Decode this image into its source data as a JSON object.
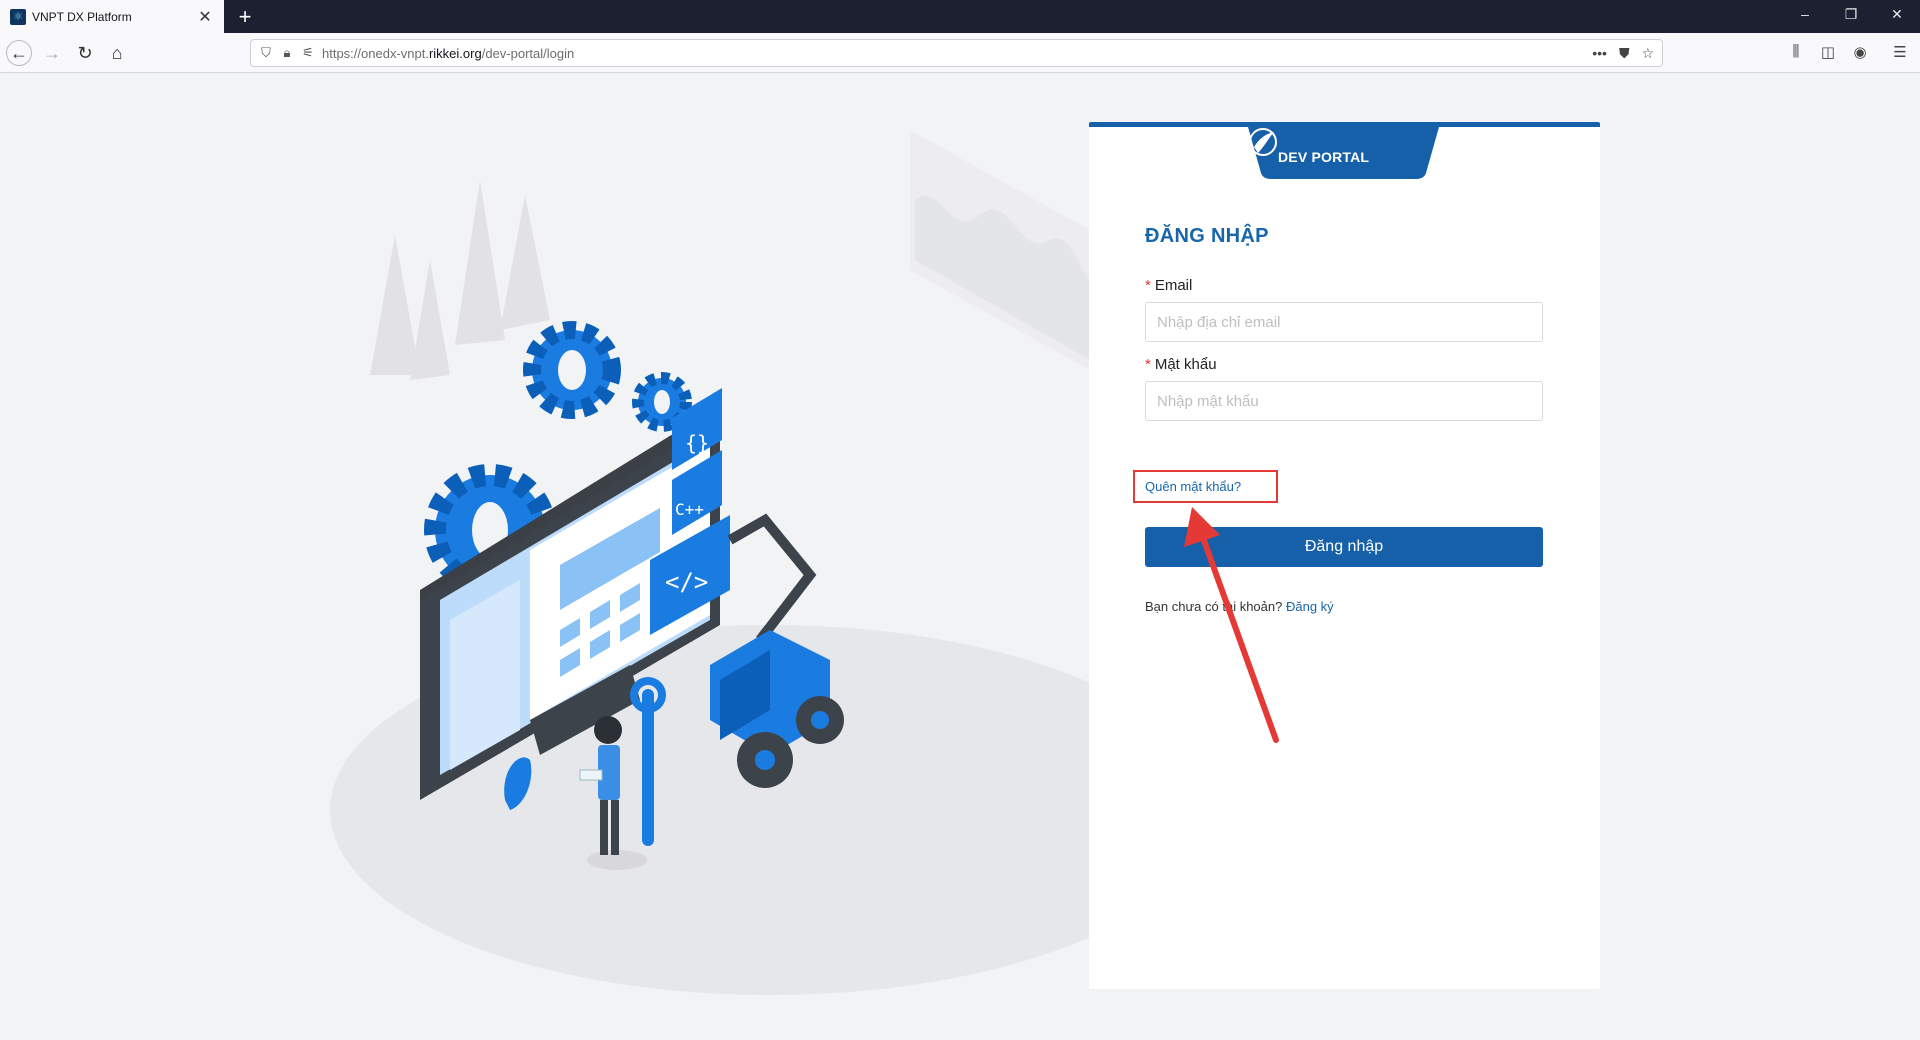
{
  "browser": {
    "tab_title": "VNPT DX Platform",
    "url_scheme": "https://onedx-vnpt.",
    "url_host": "rikkei.org",
    "url_path": "/dev-portal/login"
  },
  "card": {
    "tab_label": "DEV PORTAL",
    "title": "ĐĂNG NHẬP",
    "email": {
      "label": "Email",
      "placeholder": "Nhập địa chỉ email",
      "value": ""
    },
    "password": {
      "label": "Mật khẩu",
      "placeholder": "Nhập mật khẩu",
      "value": ""
    },
    "forgot_link": "Quên mật khẩu?",
    "submit_label": "Đăng nhập",
    "signup_prompt": "Bạn chưa có tài khoản?",
    "signup_link": "Đăng ký"
  },
  "colors": {
    "brand_blue": "#1560a8",
    "highlight_red": "#e53935",
    "illustration_blue": "#1a7be0"
  },
  "icons": [
    "app-favicon",
    "close-icon",
    "plus-icon",
    "minimize-icon",
    "restore-icon",
    "close-window-icon",
    "back-icon",
    "forward-icon",
    "reload-icon",
    "home-icon",
    "shield-icon",
    "lock-icon",
    "permissions-icon",
    "more-icon",
    "pocket-icon",
    "star-icon",
    "library-icon",
    "sidebar-icon",
    "account-icon",
    "menu-icon",
    "vnpt-logo-icon",
    "annotation-arrow-icon"
  ]
}
